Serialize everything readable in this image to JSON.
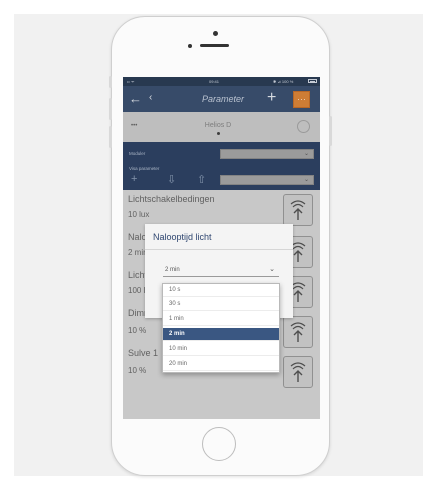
{
  "status_bar": {
    "left": "•• ᯤ",
    "time": "09:41",
    "right": "✱ ⊿ 100 %"
  },
  "nav": {
    "back": "←",
    "prev": "‹",
    "title": "Parameter",
    "add": "+",
    "action_glyph": "⋯"
  },
  "device": {
    "left_label": "•••",
    "name": "Helios D"
  },
  "select_panel": {
    "label1": "Moduler",
    "label2": "Visa parameter",
    "icons": [
      "+",
      "⇩",
      "⇧"
    ]
  },
  "params": [
    {
      "label": "Lichtschakelbedingen",
      "value": "10 lux"
    },
    {
      "label": "Nalooptijd licht",
      "value": "2 min"
    },
    {
      "label": "Lichtsterkte",
      "value": "100 lux"
    },
    {
      "label": "Dimmen",
      "value": "10 %"
    },
    {
      "label": "Sulve 1",
      "value": "10 %"
    }
  ],
  "dialog": {
    "title": "Nalooptijd licht",
    "selected": "2 min"
  },
  "dropdown": {
    "options": [
      "10 s",
      "30 s",
      "1 min",
      "2 min",
      "10 min",
      "20 min"
    ],
    "selected_index": 3
  },
  "colors": {
    "nav": "#3c5272",
    "panel": "#2f4466",
    "accent": "#e0883a",
    "selected": "#3a5782"
  },
  "icons": {
    "param_button": "motion-sensor-icon"
  }
}
